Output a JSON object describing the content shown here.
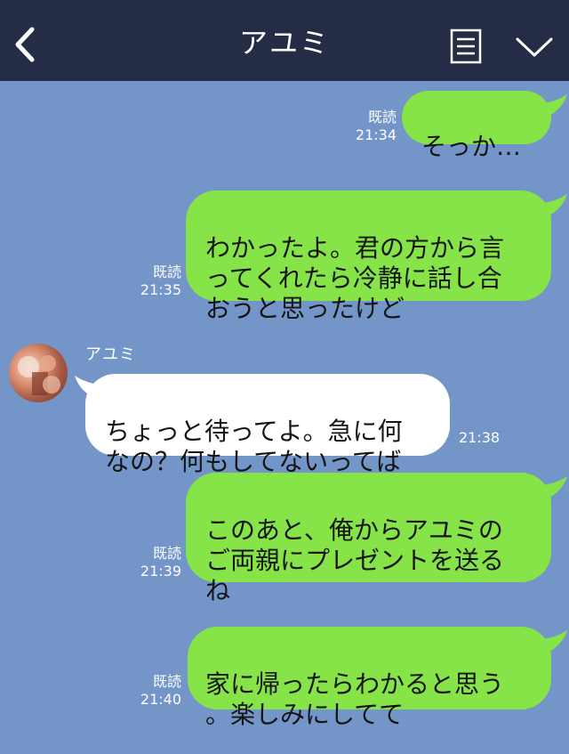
{
  "header": {
    "title": "アユミ"
  },
  "messages": [
    {
      "direction": "outgoing",
      "text": "そっか…",
      "read": "既読",
      "time": "21:34"
    },
    {
      "direction": "outgoing",
      "text": "わかったよ。君の方から言\nってくれたら冷静に話し合\nおうと思ったけど",
      "read": "既読",
      "time": "21:35"
    },
    {
      "direction": "incoming",
      "sender": "アユミ",
      "text": "ちょっと待ってよ。急に何\nなの？何もしてないってば",
      "time": "21:38"
    },
    {
      "direction": "outgoing",
      "text": "このあと、俺からアユミの\nご両親にプレゼントを送る\nね",
      "read": "既読",
      "time": "21:39"
    },
    {
      "direction": "outgoing",
      "text": "家に帰ったらわかると思う\n。楽しみにしてて",
      "read": "既読",
      "time": "21:40"
    }
  ],
  "colors": {
    "header_bg": "#242d45",
    "chat_bg": "#7495c8",
    "outgoing_bubble": "#86e348",
    "incoming_bubble": "#ffffff"
  }
}
